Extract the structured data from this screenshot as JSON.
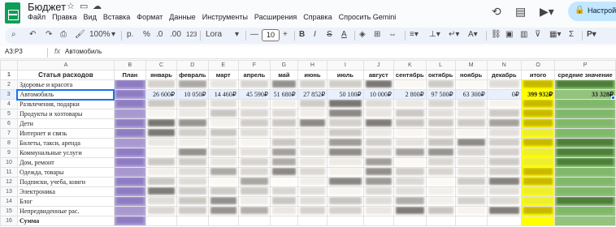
{
  "app": {
    "title": "Бюджет",
    "menu": [
      "Файл",
      "Правка",
      "Вид",
      "Вставка",
      "Формат",
      "Данные",
      "Инструменты",
      "Расширения",
      "Справка",
      "Спросить Gemini"
    ],
    "share_label": "Настрой"
  },
  "toolbar": {
    "zoom": "100%",
    "currency": "р.",
    "percent": "%",
    "dec_less": ".0",
    "dec_more": ".00",
    "num_format": "123",
    "font": "Lora",
    "font_size": "10"
  },
  "formula_bar": {
    "name_box": "A3:P3",
    "fx": "fx",
    "value": "Автомобиль"
  },
  "sheet": {
    "columns": [
      "A",
      "B",
      "C",
      "D",
      "E",
      "F",
      "G",
      "H",
      "I",
      "J",
      "K",
      "L",
      "M",
      "N",
      "O",
      "P"
    ],
    "header": [
      "Статья расходов",
      "План",
      "январь",
      "февраль",
      "март",
      "апрель",
      "май",
      "июнь",
      "июль",
      "август",
      "сентябрь",
      "октябрь",
      "ноябрь",
      "декабрь",
      "итого",
      "средние значение"
    ],
    "categories": [
      "Здоровье и красота",
      "Автомобиль",
      "Развлечения, подарки",
      "Продукты и хозтовары",
      "Дети",
      "Интернет и связь",
      "Билеты, такси, аренда",
      "Коммунальные услуги",
      "Дом, ремонт",
      "Одежда, товары",
      "Подписки, учеба, книги",
      "Электроника",
      "Блог",
      "Непредвиденные рас.",
      "Сумма"
    ],
    "row_numbers": [
      "1",
      "2",
      "3",
      "4",
      "5",
      "6",
      "7",
      "8",
      "9",
      "10",
      "11",
      "12",
      "13",
      "14",
      "15",
      "16"
    ],
    "selected_row_values": [
      "",
      "26 600₽",
      "10 050₽",
      "14 460₽",
      "45 590₽",
      "51 680₽",
      "27 852₽",
      "50 100₽",
      "10 000₽",
      "2 800₽",
      "97 500₽",
      "63 300₽",
      "0₽",
      "399 932₽",
      "33 328₽"
    ]
  },
  "colors": {
    "plan": "#b4a7d6",
    "total": "#ffff00",
    "average": "#93c47d",
    "selection": "#1a73e8"
  }
}
